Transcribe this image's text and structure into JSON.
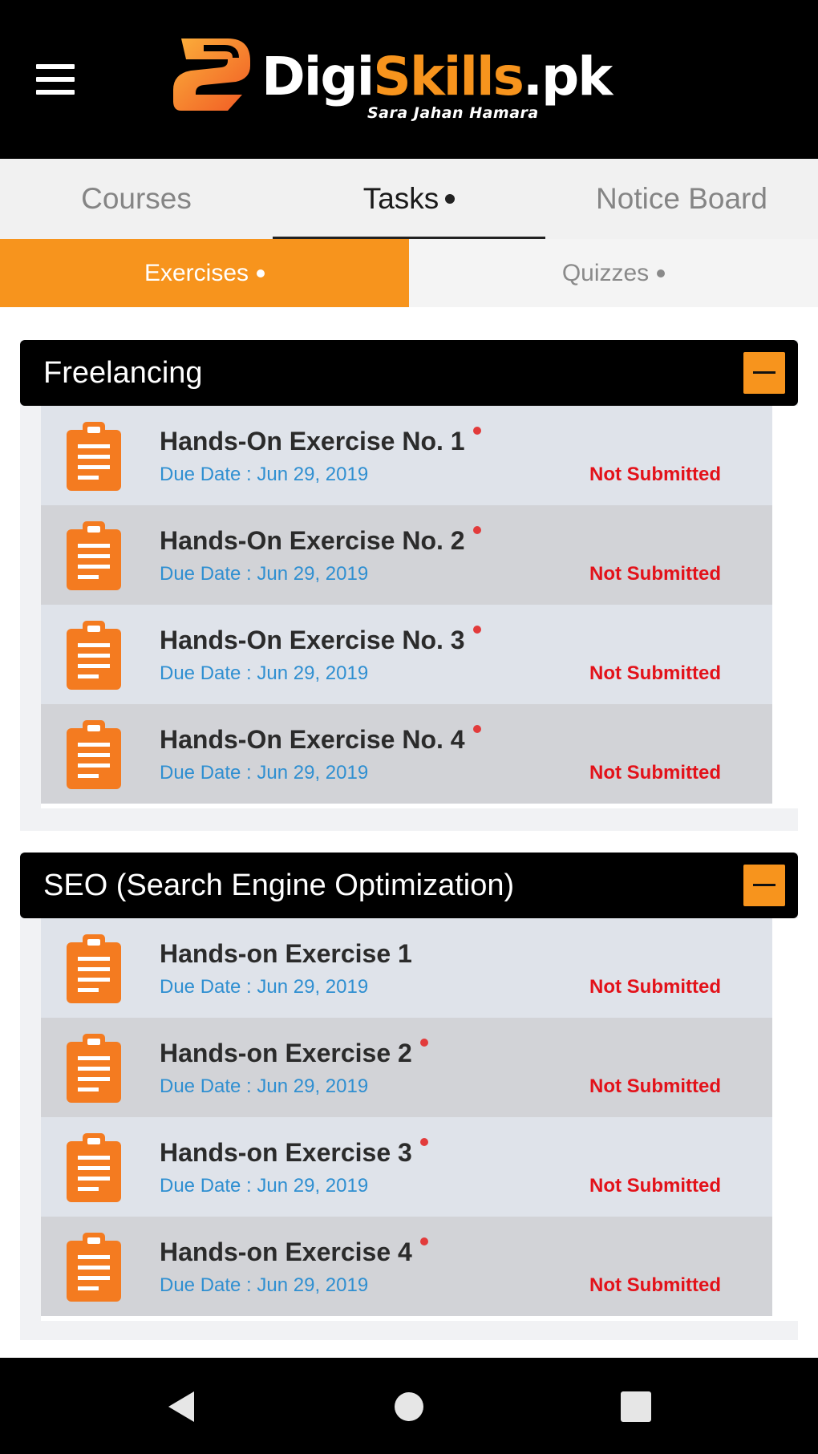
{
  "header": {
    "logo_part1": "Digi",
    "logo_part2": "Skills",
    "logo_part3": ".pk",
    "tagline": "Sara Jahan Hamara",
    "brand_color": "#f7941d"
  },
  "main_tabs": [
    {
      "label": "Courses",
      "active": false
    },
    {
      "label": "Tasks",
      "active": true
    },
    {
      "label": "Notice Board",
      "active": false
    }
  ],
  "sub_tabs": [
    {
      "label": "Exercises",
      "active": true
    },
    {
      "label": "Quizzes",
      "active": false
    }
  ],
  "sections": [
    {
      "title": "Freelancing",
      "items": [
        {
          "title": "Hands-On Exercise No. 1",
          "due": "Due Date : Jun 29, 2019",
          "status": "Not Submitted",
          "new": true
        },
        {
          "title": "Hands-On Exercise No. 2",
          "due": "Due Date : Jun 29, 2019",
          "status": "Not Submitted",
          "new": true
        },
        {
          "title": "Hands-On Exercise No. 3",
          "due": "Due Date : Jun 29, 2019",
          "status": "Not Submitted",
          "new": true
        },
        {
          "title": "Hands-On Exercise No. 4",
          "due": "Due Date : Jun 29, 2019",
          "status": "Not Submitted",
          "new": true
        }
      ]
    },
    {
      "title": "SEO (Search Engine Optimization)",
      "items": [
        {
          "title": "Hands-on Exercise 1",
          "due": "Due Date : Jun 29, 2019",
          "status": "Not Submitted",
          "new": false
        },
        {
          "title": "Hands-on Exercise 2",
          "due": "Due Date : Jun 29, 2019",
          "status": "Not Submitted",
          "new": true
        },
        {
          "title": "Hands-on Exercise 3",
          "due": "Due Date : Jun 29, 2019",
          "status": "Not Submitted",
          "new": true
        },
        {
          "title": "Hands-on Exercise 4",
          "due": "Due Date : Jun 29, 2019",
          "status": "Not Submitted",
          "new": true
        }
      ]
    }
  ],
  "icons": {
    "menu": "hamburger-menu-icon",
    "collapse": "minus-icon",
    "item": "clipboard-icon",
    "nav_back": "triangle-back-icon",
    "nav_home": "circle-home-icon",
    "nav_recents": "square-recents-icon"
  },
  "colors": {
    "accent": "#f7941d",
    "status_red": "#e3121a",
    "due_blue": "#2f8fd1",
    "row_light": "#dfe3ea",
    "row_dark": "#d2d3d7"
  }
}
